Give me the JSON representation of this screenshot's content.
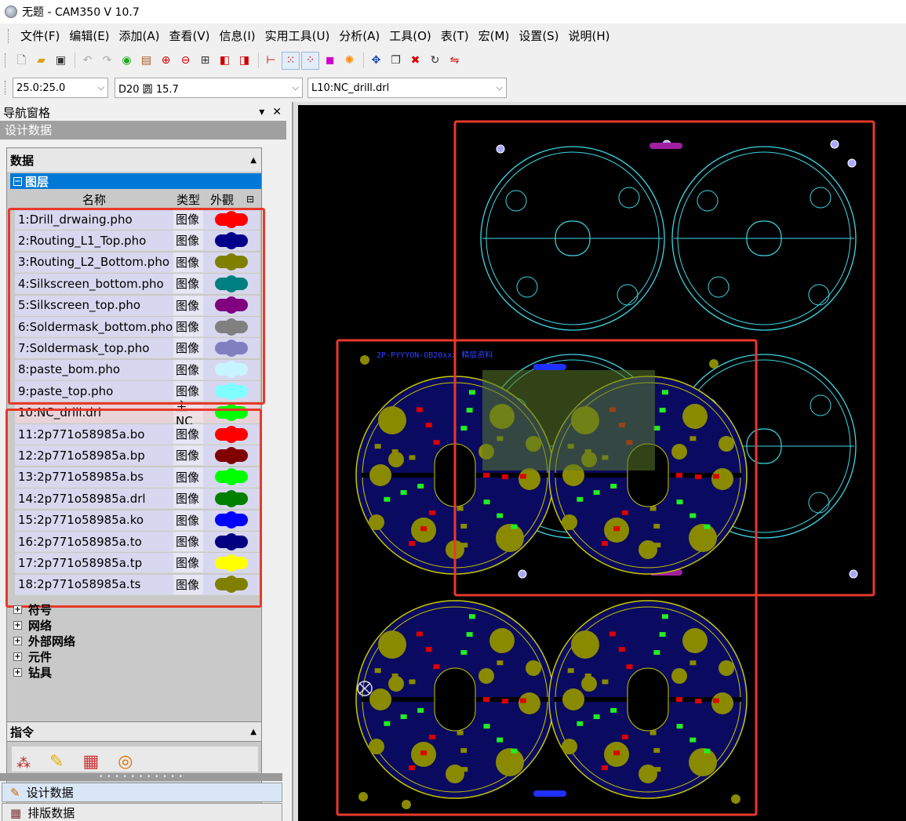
{
  "title": "无题 - CAM350 V 10.7",
  "menu": [
    "文件(F)",
    "编辑(E)",
    "添加(A)",
    "查看(V)",
    "信息(I)",
    "实用工具(U)",
    "分析(A)",
    "工具(O)",
    "表(T)",
    "宏(M)",
    "设置(S)",
    "说明(H)"
  ],
  "combos": {
    "grid": "25.0:25.0",
    "dcode": "D20  圆 15.7",
    "layer": "L10:NC_drill.drl"
  },
  "nav": {
    "title": "导航窗格",
    "pin": "▾",
    "close": "✕",
    "section": "设计数据",
    "data_head": "数据",
    "layers_label": "图层",
    "col_name": "名称",
    "col_type": "类型",
    "col_look": "外觀",
    "layers": [
      {
        "name": "1:Drill_drwaing.pho",
        "type": "图像",
        "color": "#ff0000"
      },
      {
        "name": "2:Routing_L1_Top.pho",
        "type": "图像",
        "color": "#00008b"
      },
      {
        "name": "3:Routing_L2_Bottom.pho",
        "type": "图像",
        "color": "#808000"
      },
      {
        "name": "4:Silkscreen_bottom.pho",
        "type": "图像",
        "color": "#008080"
      },
      {
        "name": "5:Silkscreen_top.pho",
        "type": "图像",
        "color": "#800080"
      },
      {
        "name": "6:Soldermask_bottom.pho",
        "type": "图像",
        "color": "#808080"
      },
      {
        "name": "7:Soldermask_top.pho",
        "type": "图像",
        "color": "#8080c0"
      },
      {
        "name": "8:paste_bom.pho",
        "type": "图像",
        "color": "#c8f4ff"
      },
      {
        "name": "9:paste_top.pho",
        "type": "图像",
        "color": "#7fffff"
      },
      {
        "name": "10:NC_drill.drl",
        "type": "主NC",
        "color": "#00ff00"
      },
      {
        "name": "11:2p771o58985a.bo",
        "type": "图像",
        "color": "#ff0000"
      },
      {
        "name": "12:2p771o58985a.bp",
        "type": "图像",
        "color": "#800000"
      },
      {
        "name": "13:2p771o58985a.bs",
        "type": "图像",
        "color": "#00ff00"
      },
      {
        "name": "14:2p771o58985a.drl",
        "type": "图像",
        "color": "#008000"
      },
      {
        "name": "15:2p771o58985a.ko",
        "type": "图像",
        "color": "#0000ff"
      },
      {
        "name": "16:2p771o58985a.to",
        "type": "图像",
        "color": "#000080"
      },
      {
        "name": "17:2p771o58985a.tp",
        "type": "图像",
        "color": "#ffff00"
      },
      {
        "name": "18:2p771o58985a.ts",
        "type": "图像",
        "color": "#808000"
      }
    ],
    "nodes": [
      "符号",
      "网络",
      "外部网络",
      "元件",
      "钻具"
    ],
    "commands": "指令",
    "tab_design": "设计数据",
    "tab_panel": "排版数据"
  },
  "canvas": {
    "label": "2P-PYYYON-OB20xxx 精层资料"
  }
}
